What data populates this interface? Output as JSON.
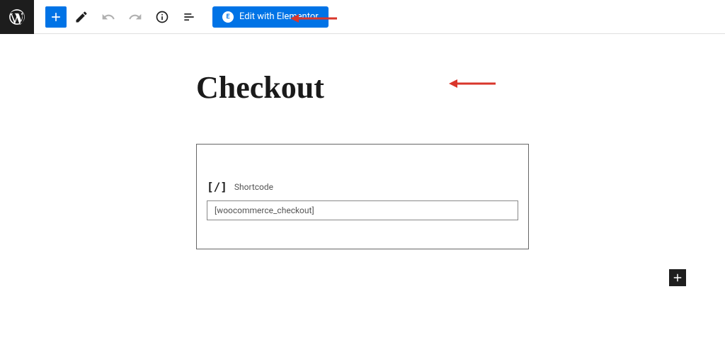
{
  "toolbar": {
    "elementor_label": "Edit with Elementor",
    "elementor_icon_text": "E"
  },
  "page": {
    "title": "Checkout"
  },
  "block": {
    "shortcode_label": "Shortcode",
    "shortcode_icon": "[/]",
    "shortcode_value": "[woocommerce_checkout]"
  }
}
